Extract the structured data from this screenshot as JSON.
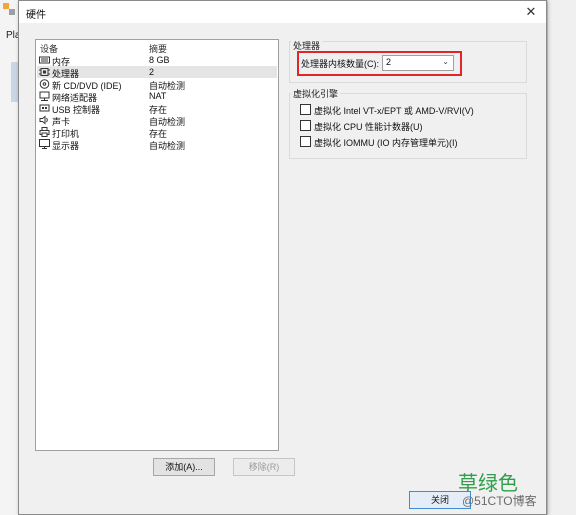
{
  "background": {
    "app_label": "Pla"
  },
  "dialog": {
    "title": "硬件"
  },
  "device_list": {
    "header_device": "设备",
    "header_summary": "摘要",
    "devices": [
      {
        "name": "内存",
        "summary": "8 GB",
        "icon": "memory-icon"
      },
      {
        "name": "处理器",
        "summary": "2",
        "icon": "processor-icon",
        "selected": true
      },
      {
        "name": "新 CD/DVD (IDE)",
        "summary": "自动检测",
        "icon": "cd-dvd-icon"
      },
      {
        "name": "网络适配器",
        "summary": "NAT",
        "icon": "network-adapter-icon"
      },
      {
        "name": "USB 控制器",
        "summary": "存在",
        "icon": "usb-icon"
      },
      {
        "name": "声卡",
        "summary": "自动检测",
        "icon": "sound-icon"
      },
      {
        "name": "打印机",
        "summary": "存在",
        "icon": "printer-icon"
      },
      {
        "name": "显示器",
        "summary": "自动检测",
        "icon": "display-icon"
      }
    ]
  },
  "buttons": {
    "add": "添加(A)...",
    "remove": "移除(R)",
    "close": "关闭"
  },
  "processor": {
    "group_title": "处理器",
    "cores_label": "处理器内核数量(C):",
    "cores_value": "2"
  },
  "virtualization": {
    "group_title": "虚拟化引擎",
    "options": [
      {
        "label": "虚拟化 Intel VT-x/EPT 或 AMD-V/RVI(V)",
        "checked": false
      },
      {
        "label": "虚拟化 CPU 性能计数器(U)",
        "checked": false
      },
      {
        "label": "虚拟化 IOMMU (IO 内存管理单元)(I)",
        "checked": false
      }
    ]
  },
  "watermark": {
    "line1": "草绿色",
    "line2": "@51CTO博客"
  },
  "colors": {
    "highlight_border": "#e0262a",
    "selected_row": "#e5e5e5",
    "watermark_green": "#2e9e4a"
  }
}
